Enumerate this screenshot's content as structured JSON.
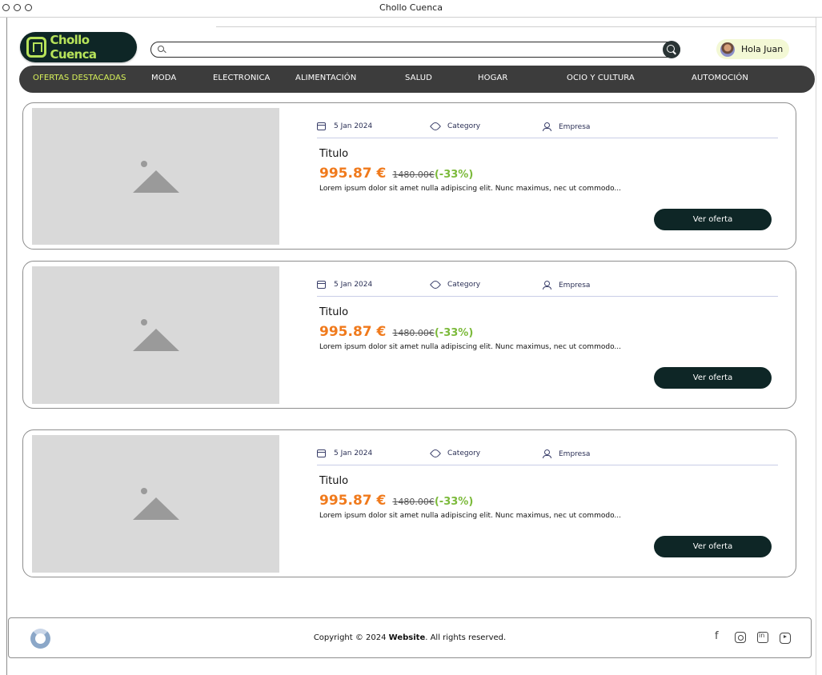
{
  "window": {
    "title": "Chollo Cuenca"
  },
  "header": {
    "logo_text": "Chollo Cuenca",
    "search": {
      "value": "",
      "placeholder": ""
    },
    "user": {
      "greeting": "Hola Juan"
    }
  },
  "nav": {
    "items": [
      {
        "label": "OFERTAS DESTACADAS",
        "active": true
      },
      {
        "label": "MODA"
      },
      {
        "label": "ELECTRONICA"
      },
      {
        "label": "ALIMENTACIÓN"
      },
      {
        "label": "SALUD"
      },
      {
        "label": "HOGAR"
      },
      {
        "label": "OCIO Y CULTURA"
      },
      {
        "label": "AUTOMOCIÓN"
      }
    ],
    "active_color": "#d8f25a"
  },
  "offers": [
    {
      "date": "5 Jan 2024",
      "category": "Category",
      "company": "Empresa",
      "title": "Titulo",
      "price": "995.87 €",
      "old_price": "1480.00€",
      "discount": "(-33%)",
      "description": "Lorem ipsum dolor sit amet nulla adipiscing elit. Nunc maximus, nec ut commodo...",
      "cta": "Ver oferta"
    },
    {
      "date": "5 Jan 2024",
      "category": "Category",
      "company": "Empresa",
      "title": "Titulo",
      "price": "995.87 €",
      "old_price": "1480.00€",
      "discount": "(-33%)",
      "description": "Lorem ipsum dolor sit amet nulla adipiscing elit. Nunc maximus, nec ut commodo...",
      "cta": "Ver oferta"
    },
    {
      "date": "5 Jan 2024",
      "category": "Category",
      "company": "Empresa",
      "title": "Titulo",
      "price": "995.87 €",
      "old_price": "1480.00€",
      "discount": "(-33%)",
      "description": "Lorem ipsum dolor sit amet nulla adipiscing elit. Nunc maximus, nec ut commodo...",
      "cta": "Ver oferta"
    }
  ],
  "footer": {
    "copyright_prefix": "Copyright © 2024 ",
    "copyright_brand": "Website",
    "copyright_suffix": ". All rights reserved.",
    "socials": [
      "facebook-icon",
      "instagram-icon",
      "linkedin-icon",
      "youtube-icon"
    ]
  },
  "colors": {
    "brand_dark": "#0e2626",
    "brand_lime": "#b7e35a",
    "price": "#f07a1c",
    "discount": "#7cba3b",
    "nav_bg": "#3c3c3c"
  }
}
